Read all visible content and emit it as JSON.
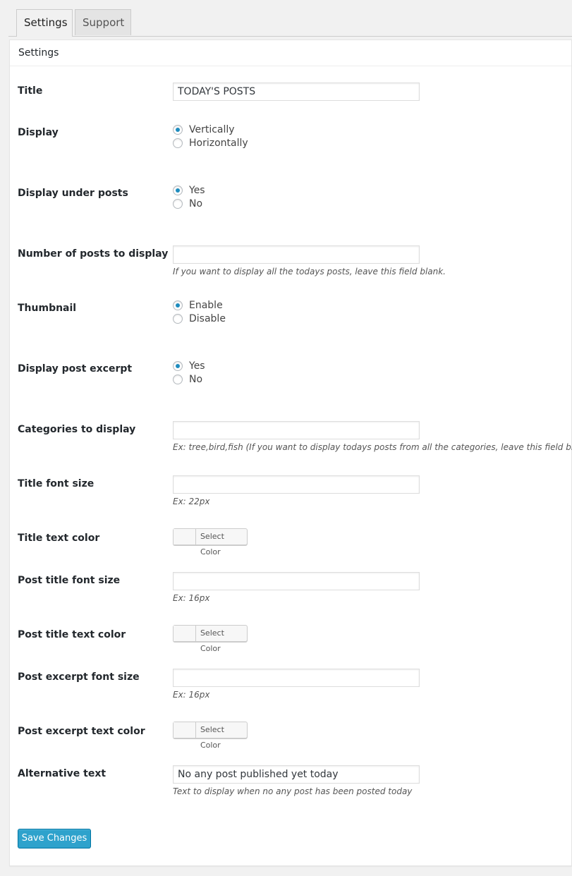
{
  "tabs": [
    {
      "label": "Settings",
      "active": true
    },
    {
      "label": "Support",
      "active": false
    }
  ],
  "panel_title": "Settings",
  "fields": {
    "title": {
      "label": "Title",
      "value": "TODAY'S POSTS"
    },
    "display": {
      "label": "Display",
      "options": [
        "Vertically",
        "Horizontally"
      ],
      "selected": "Vertically"
    },
    "display_under_posts": {
      "label": "Display under posts",
      "options": [
        "Yes",
        "No"
      ],
      "selected": "Yes"
    },
    "num_posts": {
      "label": "Number of posts to display",
      "value": "",
      "desc": "If you want to display all the todays posts, leave this field blank."
    },
    "thumbnail": {
      "label": "Thumbnail",
      "options": [
        "Enable",
        "Disable"
      ],
      "selected": "Enable"
    },
    "post_excerpt": {
      "label": "Display post excerpt",
      "options": [
        "Yes",
        "No"
      ],
      "selected": "Yes"
    },
    "categories": {
      "label": "Categories to display",
      "value": "",
      "desc": "Ex: tree,bird,fish (If you want to display todays posts from all the categories, leave this field blank)"
    },
    "title_font_size": {
      "label": "Title font size",
      "value": "",
      "desc": "Ex: 22px"
    },
    "title_text_color": {
      "label": "Title text color",
      "button": "Select Color"
    },
    "post_title_font_size": {
      "label": "Post title font size",
      "value": "",
      "desc": "Ex: 16px"
    },
    "post_title_text_color": {
      "label": "Post title text color",
      "button": "Select Color"
    },
    "post_excerpt_font_size": {
      "label": "Post excerpt font size",
      "value": "",
      "desc": "Ex: 16px"
    },
    "post_excerpt_text_color": {
      "label": "Post excerpt text color",
      "button": "Select Color"
    },
    "alt_text": {
      "label": "Alternative text",
      "value": "No any post published yet today",
      "desc": "Text to display when no any post has been posted today"
    }
  },
  "save_label": "Save Changes"
}
